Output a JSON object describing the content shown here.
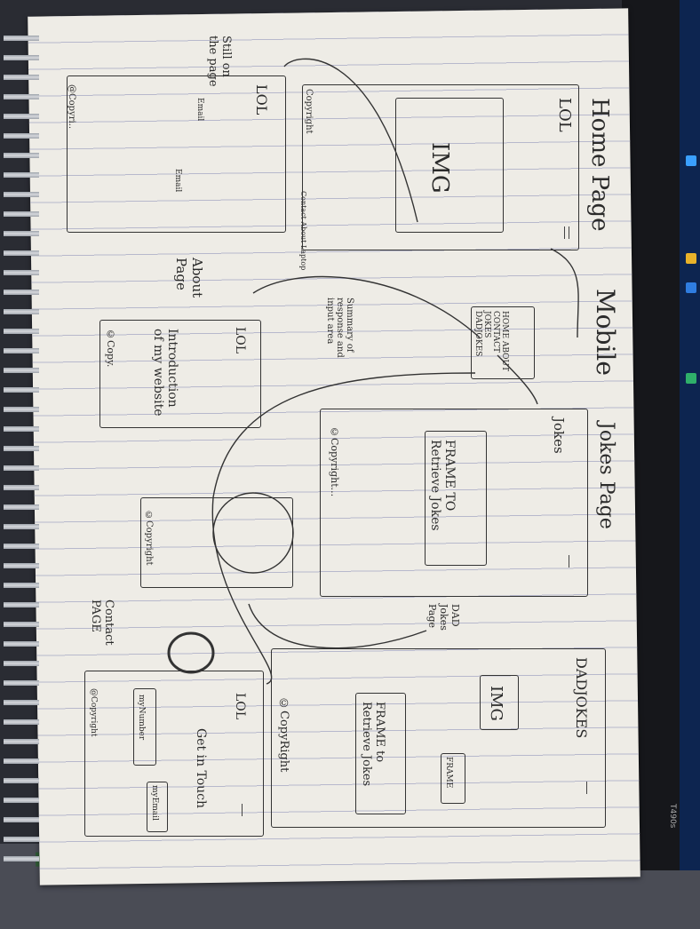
{
  "laptop": {
    "model": "T490s",
    "accent": "#0d2550"
  },
  "title": "Mobile",
  "home": {
    "title": "Home Page",
    "logo": "LOL",
    "image": "IMG",
    "footer": "Copyright",
    "footer_links": "Contact About Laptop",
    "note": "Still on the page",
    "logo2": "LOL",
    "email1": "Email",
    "email2": "Email",
    "footer2": "@Copyri.."
  },
  "menu": {
    "items": [
      "HOME",
      "ABOUT",
      "CONTACT",
      "JOKES",
      "DADJOKES"
    ]
  },
  "jokes": {
    "title": "Jokes Page",
    "header": "Jokes",
    "frame": "FRAME TO Retrieve Jokes",
    "note": "Summary of response and input area",
    "footer": "©Copyright..."
  },
  "about": {
    "title": "About Page",
    "logo": "LOL",
    "intro": "Introduction of my website",
    "footer": "©Copy.",
    "footer2": "©Copyright"
  },
  "dadjokes": {
    "title": "DAD Jokes Page",
    "header": "DADJOKES",
    "image": "IMG",
    "frame_small": "FRAME",
    "frame": "FRAME to Retrieve Jokes",
    "footer": "©CopyRight"
  },
  "contact": {
    "title": "Contact PAGE",
    "logo": "LOL",
    "heading": "Get in Touch",
    "number": "myNumber",
    "email": "myEmail",
    "footer": "@Copyright"
  }
}
